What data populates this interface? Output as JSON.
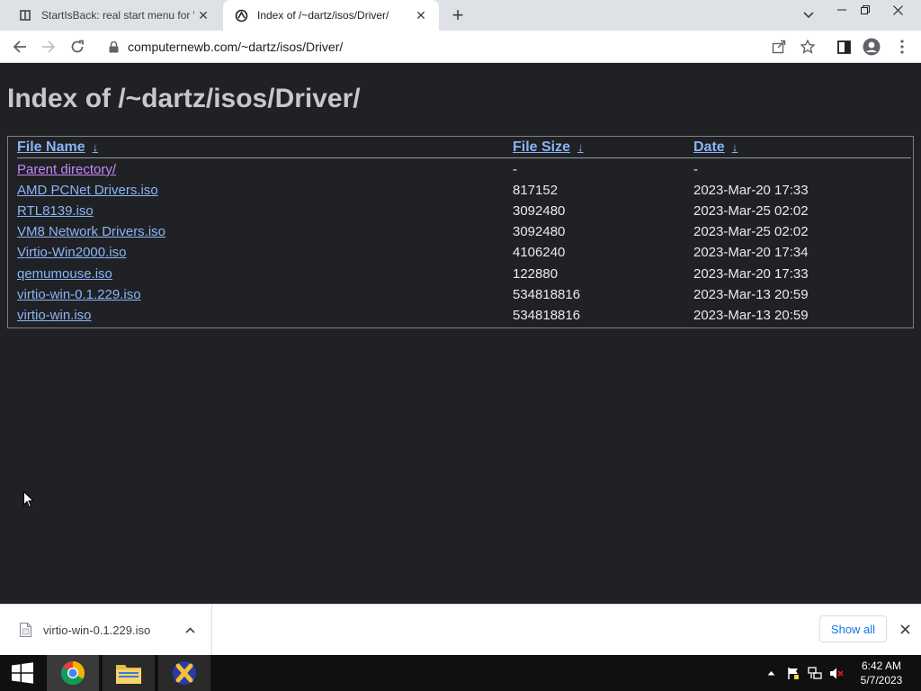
{
  "browser": {
    "tabs": [
      {
        "title": "StartIsBack: real start menu for W",
        "active": false
      },
      {
        "title": "Index of /~dartz/isos/Driver/",
        "active": true
      }
    ],
    "url": "computernewb.com/~dartz/isos/Driver/"
  },
  "page": {
    "title": "Index of /~dartz/isos/Driver/",
    "columns": {
      "name": "File Name",
      "size": "File Size",
      "date": "Date",
      "sort_arrow": "↓"
    },
    "rows": [
      {
        "name": "Parent directory/",
        "size": "-",
        "date": "-"
      },
      {
        "name": "AMD PCNet Drivers.iso",
        "size": "817152",
        "date": "2023-Mar-20 17:33"
      },
      {
        "name": "RTL8139.iso",
        "size": "3092480",
        "date": "2023-Mar-25 02:02"
      },
      {
        "name": "VM8 Network Drivers.iso",
        "size": "3092480",
        "date": "2023-Mar-25 02:02"
      },
      {
        "name": "Virtio-Win2000.iso",
        "size": "4106240",
        "date": "2023-Mar-20 17:34"
      },
      {
        "name": "qemumouse.iso",
        "size": "122880",
        "date": "2023-Mar-20 17:33"
      },
      {
        "name": "virtio-win-0.1.229.iso",
        "size": "534818816",
        "date": "2023-Mar-13 20:59"
      },
      {
        "name": "virtio-win.iso",
        "size": "534818816",
        "date": "2023-Mar-13 20:59"
      }
    ]
  },
  "downloads": {
    "item": "virtio-win-0.1.229.iso",
    "show_all": "Show all"
  },
  "taskbar": {
    "time": "6:42 AM",
    "date": "5/7/2023"
  },
  "colors": {
    "page_bg": "#202124",
    "link": "#8ab4f8",
    "visited_link": "#c58af9"
  }
}
